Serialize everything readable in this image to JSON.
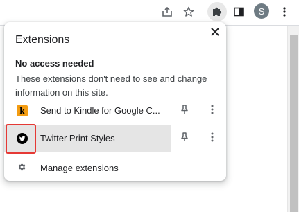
{
  "toolbar": {
    "share_icon": "share-icon",
    "bookmark_icon": "star-icon",
    "extensions_icon": "puzzle-icon",
    "sidepanel_icon": "side-panel-icon",
    "profile_initial": "S",
    "menu_icon": "kebab-menu-icon"
  },
  "popup": {
    "title": "Extensions",
    "close_icon": "close-icon",
    "section": {
      "heading": "No access needed",
      "description": "These extensions don't need to see and change information on this site."
    },
    "extensions": [
      {
        "name": "Send to Kindle for Google C...",
        "icon": "kindle-icon",
        "icon_letter": "k",
        "pin_icon": "pin-icon",
        "more_icon": "more-vert-icon"
      },
      {
        "name": "Twitter Print Styles",
        "icon": "twitter-bird-icon",
        "pin_icon": "pin-icon",
        "more_icon": "more-vert-icon"
      }
    ],
    "manage": {
      "label": "Manage extensions",
      "icon": "gear-icon"
    }
  },
  "colors": {
    "highlight_border": "#e53935",
    "selected_row_bg": "#e5e5e5",
    "avatar_bg": "#6e7b83",
    "kindle_orange": "#f39c12"
  }
}
